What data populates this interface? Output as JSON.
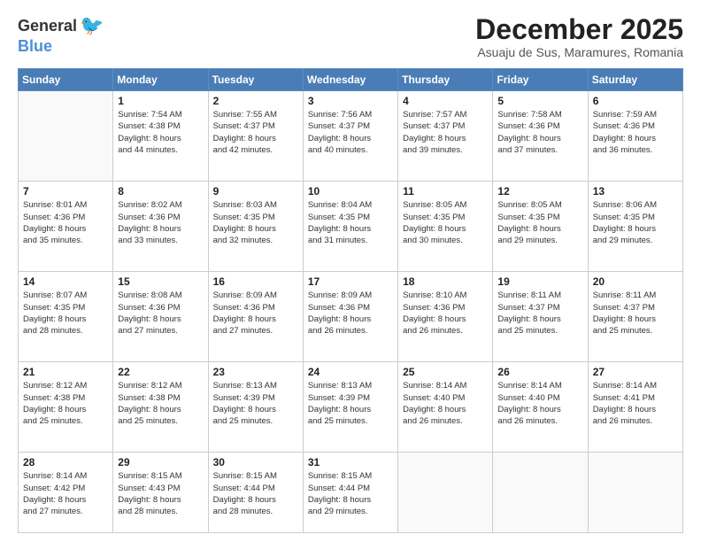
{
  "header": {
    "logo_general": "General",
    "logo_blue": "Blue",
    "month_title": "December 2025",
    "location": "Asuaju de Sus, Maramures, Romania"
  },
  "weekdays": [
    "Sunday",
    "Monday",
    "Tuesday",
    "Wednesday",
    "Thursday",
    "Friday",
    "Saturday"
  ],
  "weeks": [
    [
      {
        "day": "",
        "info": ""
      },
      {
        "day": "1",
        "info": "Sunrise: 7:54 AM\nSunset: 4:38 PM\nDaylight: 8 hours\nand 44 minutes."
      },
      {
        "day": "2",
        "info": "Sunrise: 7:55 AM\nSunset: 4:37 PM\nDaylight: 8 hours\nand 42 minutes."
      },
      {
        "day": "3",
        "info": "Sunrise: 7:56 AM\nSunset: 4:37 PM\nDaylight: 8 hours\nand 40 minutes."
      },
      {
        "day": "4",
        "info": "Sunrise: 7:57 AM\nSunset: 4:37 PM\nDaylight: 8 hours\nand 39 minutes."
      },
      {
        "day": "5",
        "info": "Sunrise: 7:58 AM\nSunset: 4:36 PM\nDaylight: 8 hours\nand 37 minutes."
      },
      {
        "day": "6",
        "info": "Sunrise: 7:59 AM\nSunset: 4:36 PM\nDaylight: 8 hours\nand 36 minutes."
      }
    ],
    [
      {
        "day": "7",
        "info": "Sunrise: 8:01 AM\nSunset: 4:36 PM\nDaylight: 8 hours\nand 35 minutes."
      },
      {
        "day": "8",
        "info": "Sunrise: 8:02 AM\nSunset: 4:36 PM\nDaylight: 8 hours\nand 33 minutes."
      },
      {
        "day": "9",
        "info": "Sunrise: 8:03 AM\nSunset: 4:35 PM\nDaylight: 8 hours\nand 32 minutes."
      },
      {
        "day": "10",
        "info": "Sunrise: 8:04 AM\nSunset: 4:35 PM\nDaylight: 8 hours\nand 31 minutes."
      },
      {
        "day": "11",
        "info": "Sunrise: 8:05 AM\nSunset: 4:35 PM\nDaylight: 8 hours\nand 30 minutes."
      },
      {
        "day": "12",
        "info": "Sunrise: 8:05 AM\nSunset: 4:35 PM\nDaylight: 8 hours\nand 29 minutes."
      },
      {
        "day": "13",
        "info": "Sunrise: 8:06 AM\nSunset: 4:35 PM\nDaylight: 8 hours\nand 29 minutes."
      }
    ],
    [
      {
        "day": "14",
        "info": "Sunrise: 8:07 AM\nSunset: 4:35 PM\nDaylight: 8 hours\nand 28 minutes."
      },
      {
        "day": "15",
        "info": "Sunrise: 8:08 AM\nSunset: 4:36 PM\nDaylight: 8 hours\nand 27 minutes."
      },
      {
        "day": "16",
        "info": "Sunrise: 8:09 AM\nSunset: 4:36 PM\nDaylight: 8 hours\nand 27 minutes."
      },
      {
        "day": "17",
        "info": "Sunrise: 8:09 AM\nSunset: 4:36 PM\nDaylight: 8 hours\nand 26 minutes."
      },
      {
        "day": "18",
        "info": "Sunrise: 8:10 AM\nSunset: 4:36 PM\nDaylight: 8 hours\nand 26 minutes."
      },
      {
        "day": "19",
        "info": "Sunrise: 8:11 AM\nSunset: 4:37 PM\nDaylight: 8 hours\nand 25 minutes."
      },
      {
        "day": "20",
        "info": "Sunrise: 8:11 AM\nSunset: 4:37 PM\nDaylight: 8 hours\nand 25 minutes."
      }
    ],
    [
      {
        "day": "21",
        "info": "Sunrise: 8:12 AM\nSunset: 4:38 PM\nDaylight: 8 hours\nand 25 minutes."
      },
      {
        "day": "22",
        "info": "Sunrise: 8:12 AM\nSunset: 4:38 PM\nDaylight: 8 hours\nand 25 minutes."
      },
      {
        "day": "23",
        "info": "Sunrise: 8:13 AM\nSunset: 4:39 PM\nDaylight: 8 hours\nand 25 minutes."
      },
      {
        "day": "24",
        "info": "Sunrise: 8:13 AM\nSunset: 4:39 PM\nDaylight: 8 hours\nand 25 minutes."
      },
      {
        "day": "25",
        "info": "Sunrise: 8:14 AM\nSunset: 4:40 PM\nDaylight: 8 hours\nand 26 minutes."
      },
      {
        "day": "26",
        "info": "Sunrise: 8:14 AM\nSunset: 4:40 PM\nDaylight: 8 hours\nand 26 minutes."
      },
      {
        "day": "27",
        "info": "Sunrise: 8:14 AM\nSunset: 4:41 PM\nDaylight: 8 hours\nand 26 minutes."
      }
    ],
    [
      {
        "day": "28",
        "info": "Sunrise: 8:14 AM\nSunset: 4:42 PM\nDaylight: 8 hours\nand 27 minutes."
      },
      {
        "day": "29",
        "info": "Sunrise: 8:15 AM\nSunset: 4:43 PM\nDaylight: 8 hours\nand 28 minutes."
      },
      {
        "day": "30",
        "info": "Sunrise: 8:15 AM\nSunset: 4:44 PM\nDaylight: 8 hours\nand 28 minutes."
      },
      {
        "day": "31",
        "info": "Sunrise: 8:15 AM\nSunset: 4:44 PM\nDaylight: 8 hours\nand 29 minutes."
      },
      {
        "day": "",
        "info": ""
      },
      {
        "day": "",
        "info": ""
      },
      {
        "day": "",
        "info": ""
      }
    ]
  ]
}
